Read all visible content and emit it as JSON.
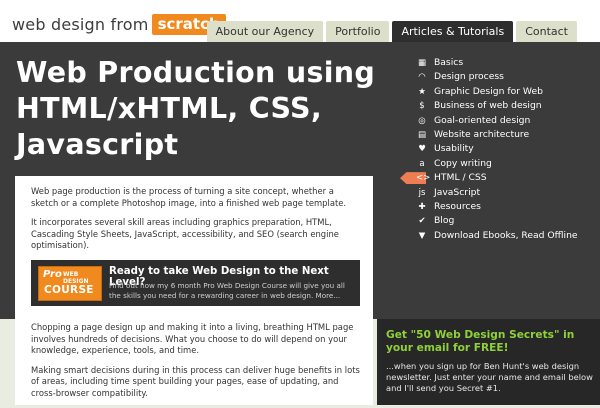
{
  "logo": {
    "main": "web design from",
    "badge": "scratch"
  },
  "nav": [
    {
      "label": "About our Agency",
      "active": false
    },
    {
      "label": "Portfolio",
      "active": false
    },
    {
      "label": "Articles & Tutorials",
      "active": true
    },
    {
      "label": "Contact",
      "active": false
    }
  ],
  "hero": {
    "title": "Web Production using HTML/xHTML, CSS, Javascript"
  },
  "menu": [
    {
      "icon": "grid-icon",
      "glyph": "▦",
      "label": "Basics"
    },
    {
      "icon": "arc-icon",
      "glyph": "◠",
      "label": "Design process"
    },
    {
      "icon": "star-icon",
      "glyph": "★",
      "label": "Graphic Design for Web"
    },
    {
      "icon": "dollar-icon",
      "glyph": "$",
      "label": "Business of web design"
    },
    {
      "icon": "target-icon",
      "glyph": "◎",
      "label": "Goal-oriented design"
    },
    {
      "icon": "sitemap-icon",
      "glyph": "▤",
      "label": "Website architecture"
    },
    {
      "icon": "heart-icon",
      "glyph": "♥",
      "label": "Usability"
    },
    {
      "icon": "letter-a-icon",
      "glyph": "a",
      "label": "Copy writing"
    },
    {
      "icon": "code-icon",
      "glyph": "<>",
      "label": "HTML / CSS",
      "current": true
    },
    {
      "icon": "js-icon",
      "glyph": "js",
      "label": "JavaScript"
    },
    {
      "icon": "gear-icon",
      "glyph": "✚",
      "label": "Resources"
    },
    {
      "icon": "check-icon",
      "glyph": "✔",
      "label": "Blog"
    },
    {
      "icon": "download-icon",
      "glyph": "▼",
      "label": "Download Ebooks, Read Offline"
    }
  ],
  "content": {
    "p1": "Web page production is the process of turning a site concept, whether a sketch or a complete Photoshop image, into a finished web page template.",
    "p2": "It incorporates several skill areas including graphics preparation, HTML, Cascading Style Sheets, JavaScript, accessibility, and SEO (search engine optimisation).",
    "promo": {
      "badge_pro": "Pro",
      "badge_wd": "WEB DESIGN",
      "badge_course": "COURSE",
      "heading": "Ready to take Web Design to the Next Level?",
      "text": "Find out how my 6 month Pro Web Design Course will give you all the skills you need for a rewarding career in web design. More..."
    },
    "p3": "Chopping a page design up and making it into a living, breathing HTML page involves hundreds of decisions. What you choose to do will depend on your knowledge, experience, tools, and time.",
    "p4": "Making smart decisions during in this process can deliver huge benefits in lots of areas, including time spent building your pages, ease of updating, and cross-browser compatibility."
  },
  "newsletter": {
    "heading": "Get \"50 Web Design Secrets\" in your email for FREE!",
    "text": "...when you sign up for Ben Hunt's web design newsletter. Just enter your name and email below and I'll send you Secret #1."
  },
  "colors": {
    "accent": "#f08a1f",
    "current": "#ee7d52",
    "green": "#8fd13b",
    "dark": "#3b3b3b"
  }
}
